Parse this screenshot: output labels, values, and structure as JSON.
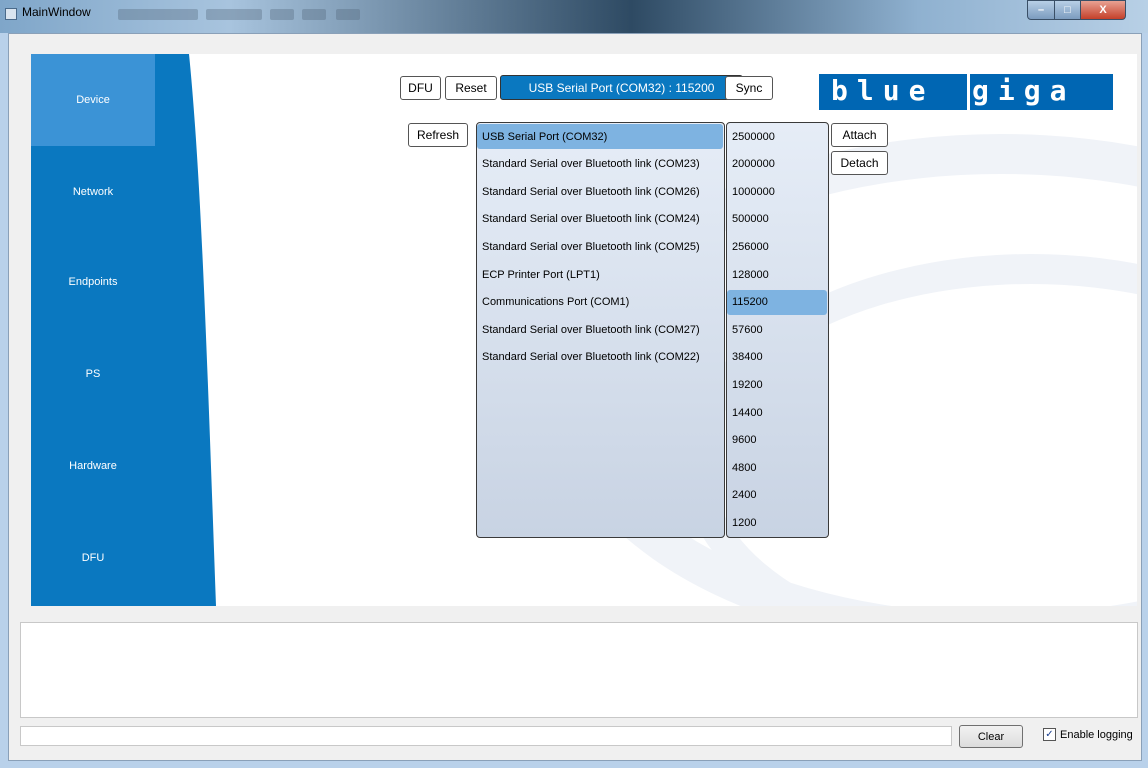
{
  "window": {
    "title": "MainWindow",
    "controls": {
      "minimize": "–",
      "maximize": "□",
      "close": "X"
    }
  },
  "sidebar": {
    "items": [
      {
        "label": "Device",
        "active": true
      },
      {
        "label": "Network",
        "active": false
      },
      {
        "label": "Endpoints",
        "active": false
      },
      {
        "label": "PS",
        "active": false
      },
      {
        "label": "Hardware",
        "active": false
      },
      {
        "label": "DFU",
        "active": false
      }
    ]
  },
  "toolbar": {
    "dfu_label": "DFU",
    "reset_label": "Reset",
    "port_display": "USB Serial Port (COM32) : 115200",
    "sync_label": "Sync"
  },
  "logo": {
    "part1": "blue",
    "part2": "giga"
  },
  "device": {
    "refresh_label": "Refresh",
    "attach_label": "Attach",
    "detach_label": "Detach",
    "ports": [
      "USB Serial Port (COM32)",
      "Standard Serial over Bluetooth link (COM23)",
      "Standard Serial over Bluetooth link (COM26)",
      "Standard Serial over Bluetooth link (COM24)",
      "Standard Serial over Bluetooth link (COM25)",
      "ECP Printer Port (LPT1)",
      "Communications Port (COM1)",
      "Standard Serial over Bluetooth link (COM27)",
      "Standard Serial over Bluetooth link (COM22)"
    ],
    "selected_port": "USB Serial Port (COM32)",
    "baud_rates": [
      "2500000",
      "2000000",
      "1000000",
      "500000",
      "256000",
      "128000",
      "115200",
      "57600",
      "38400",
      "19200",
      "14400",
      "9600",
      "4800",
      "2400",
      "1200"
    ],
    "selected_baud": "115200"
  },
  "log": {
    "content": "",
    "input_value": "",
    "clear_label": "Clear",
    "enable_logging_label": "Enable logging",
    "enable_logging_checked": true,
    "checkmark": "✓"
  },
  "colors": {
    "sidebar_blue": "#0a78c0",
    "sidebar_active": "#3b93d6",
    "logo_blue": "#0066b3",
    "selection": "#7eb3e1"
  }
}
